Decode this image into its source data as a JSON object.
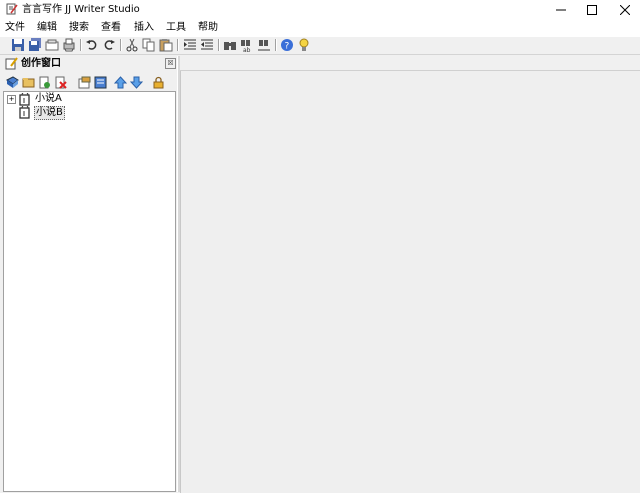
{
  "window": {
    "title": "言言写作 JJ Writer Studio",
    "controls": {
      "minimize": "─",
      "maximize": "☐",
      "close": "✕"
    }
  },
  "menu": [
    "文件",
    "编辑",
    "搜索",
    "查看",
    "插入",
    "工具",
    "帮助"
  ],
  "toolbar": {
    "buttons": [
      "save-icon",
      "save-all-icon",
      "open-icon",
      "print-icon",
      "undo-icon",
      "redo-icon",
      "cut-icon",
      "copy-icon",
      "paste-icon",
      "indent-icon",
      "outdent-icon",
      "find-icon",
      "replace-icon",
      "find-next-icon",
      "help-icon",
      "tip-icon"
    ]
  },
  "panel": {
    "title": "创作窗口",
    "close": "☒",
    "toolbar_buttons": [
      "book-icon",
      "folder-icon",
      "new-chapter-icon",
      "delete-icon",
      "properties-icon",
      "notes-icon",
      "move-up-icon",
      "move-down-icon",
      "lock-icon"
    ]
  },
  "tree": {
    "items": [
      {
        "label": "小说A",
        "expander": "+"
      },
      {
        "label": "小说B",
        "expander": ""
      }
    ]
  }
}
